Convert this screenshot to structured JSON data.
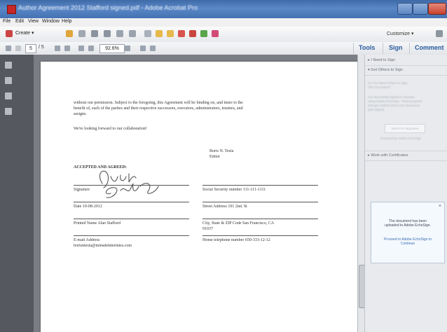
{
  "window": {
    "title": "Author Agreement 2012 Stafford signed.pdf - Adobe Acrobat Pro"
  },
  "menu": [
    "File",
    "Edit",
    "View",
    "Window",
    "Help"
  ],
  "toolbar": {
    "create_label": "Create",
    "customize_label": "Customize"
  },
  "nav": {
    "current_page": "5",
    "total_pages": "/ 5",
    "zoom": "92.6%"
  },
  "tabs": {
    "tools": "Tools",
    "sign": "Sign",
    "comment": "Comment"
  },
  "document": {
    "para1_line1": "without our permission.  Subject to the foregoing, this Agreement will be binding on, and inure to the",
    "para1_line2": "benefit of, each of the parties and their respective successors, executors, administrators, trustees, and",
    "para1_line3": "assigns.",
    "para2": "We're looking forward to our collaboration!",
    "signer_name": "Boris N. Tesla",
    "signer_title": "Editor",
    "accepted": "ACCEPTED AND AGREED:",
    "signature": "Signature",
    "ssn": "Social Security number 111-111-1111",
    "date": "Date 10-08-2012",
    "street": "Street Address 101 2nd. St",
    "printed_name": "Printed Name Alan Stafford",
    "city_line1": "City, State & ZIP Code San Francisco, CA",
    "city_line2": "91037",
    "email_label": "E-mail Address",
    "email": "borisntesla@minsdeintermies.com",
    "phone": "Home telephone number 650-333-12-12"
  },
  "sign_pane": {
    "need_to_sign": "I Need to Sign",
    "get_others": "Get Others to Sign",
    "question_line1": "Do You Need Others to Sign",
    "question_line2": "This Document?",
    "desc_line1": "Get documents signed in minutes",
    "desc_line2": "using Adobe EchoSign. Track progress",
    "desc_line3": "and get notified when your document",
    "desc_line4": "gets signed.",
    "send_button": "Send For Signature",
    "powered_by": "Powered by Adobe EchoSign",
    "work_with_certs": "Work with Certificates"
  },
  "popup": {
    "message_line1": "The document has been",
    "message_line2": "uploaded to Adobe EchoSign.",
    "link_line1": "Proceed to Adobe EchoSign to",
    "link_line2": "Continue"
  },
  "colors": {
    "title_bar": "#4a78b8",
    "tab_text": "#2a5b9e",
    "nav_pane": "#55595f",
    "doc_background": "#7a7e84"
  }
}
